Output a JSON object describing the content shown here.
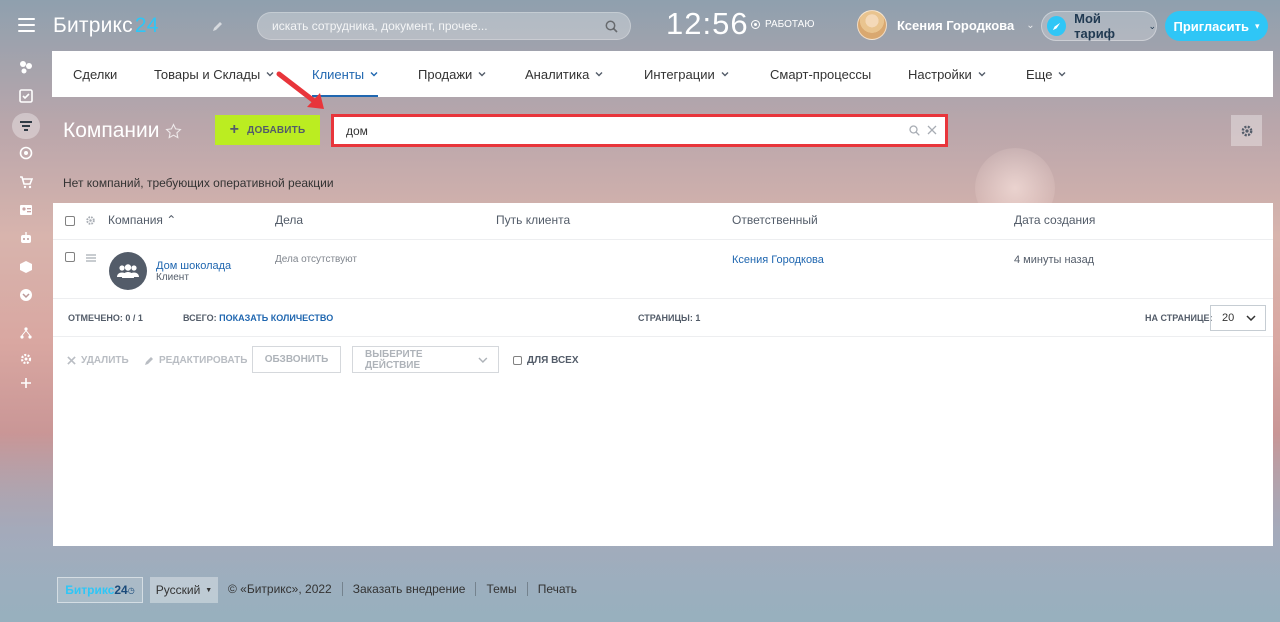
{
  "header": {
    "logo_text": "Битрикс",
    "logo_num": "24",
    "search_placeholder": "искать сотрудника, документ, прочее...",
    "clock": "12:56",
    "work_status": "РАБОТАЮ",
    "user_name": "Ксения Городкова",
    "tariff_label": "Мой тариф",
    "invite_label": "Пригласить"
  },
  "nav": {
    "items": [
      {
        "label": "Сделки"
      },
      {
        "label": "Товары и Склады"
      },
      {
        "label": "Клиенты"
      },
      {
        "label": "Продажи"
      },
      {
        "label": "Аналитика"
      },
      {
        "label": "Интеграции"
      },
      {
        "label": "Смарт-процессы"
      },
      {
        "label": "Настройки"
      },
      {
        "label": "Еще"
      }
    ]
  },
  "page": {
    "title": "Компании",
    "add_label": "ДОБАВИТЬ",
    "filter_value": "дом",
    "reaction_text": "Нет компаний, требующих оперативной реакции"
  },
  "grid": {
    "columns": {
      "company": "Компания",
      "activities": "Дела",
      "path": "Путь клиента",
      "responsible": "Ответственный",
      "created": "Дата создания"
    },
    "rows": [
      {
        "name": "Дом шоколада",
        "type": "Клиент",
        "activities": "Дела отсутствуют",
        "responsible": "Ксения Городкова",
        "created": "4 минуты назад"
      }
    ],
    "footer": {
      "selected_label": "ОТМЕЧЕНО:",
      "selected_value": "0 / 1",
      "total_label": "ВСЕГО:",
      "total_link": "ПОКАЗАТЬ КОЛИЧЕСТВО",
      "pages_label": "СТРАНИЦЫ:",
      "pages_value": "1",
      "per_page_label": "НА СТРАНИЦЕ:",
      "per_page_value": "20"
    },
    "actions": {
      "delete": "УДАЛИТЬ",
      "edit": "РЕДАКТИРОВАТЬ",
      "call": "ОБЗВОНИТЬ",
      "choose_action": "ВЫБЕРИТЕ ДЕЙСТВИЕ",
      "for_all": "ДЛЯ ВСЕХ"
    }
  },
  "footer": {
    "logo_text": "Битрикс",
    "logo_num": "24",
    "language": "Русский",
    "copyright": "© «Битрикс», 2022",
    "links": [
      "Заказать внедрение",
      "Темы",
      "Печать"
    ]
  },
  "colors": {
    "accent": "#2fc6f6",
    "link": "#2067b0",
    "add_button": "#bbed21",
    "highlight": "#e8353b"
  }
}
